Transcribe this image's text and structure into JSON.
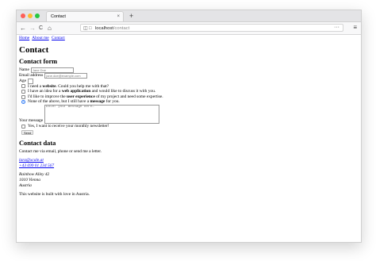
{
  "browser": {
    "tab_title": "Contact",
    "tab_close": "×",
    "new_tab": "+",
    "url_host": "localhost",
    "url_path": "/contact",
    "url_more": "···",
    "back": "←",
    "forward": "→",
    "reload": "C",
    "home": "⌂",
    "menu": "≡"
  },
  "nav": {
    "home": "Home",
    "about": "About me",
    "contact": "Contact"
  },
  "page": {
    "title": "Contact",
    "form_heading": "Contact form",
    "name_label": "Name",
    "name_placeholder": "Jane Doe",
    "email_label": "Email address",
    "email_placeholder": "jane.doe@example.com",
    "age_label": "Age",
    "options": [
      {
        "pre": "I need a ",
        "bold": "website",
        "post": ". Could you help me with that?"
      },
      {
        "pre": "I have an idea for a ",
        "bold": "web application",
        "post": " and would like to discuss it with you."
      },
      {
        "pre": "I'd like to improve the ",
        "bold": "user experience",
        "post": " of my project and need some expertise."
      },
      {
        "pre": "None of the above, but I still have a ",
        "bold": "message",
        "post": " for you."
      }
    ],
    "message_label": "Your message",
    "message_placeholder": "Enter your message here…",
    "newsletter_label": "Yes, I want to receive your monthly newsletter!",
    "send_label": "Send",
    "data_heading": "Contact data",
    "data_intro": "Contact me via email, phone or send me a letter.",
    "email": "lara@xcale.at",
    "phone": "+43 699 01 234 567",
    "address_street": "Rainbow Alley 42",
    "address_city": "1010 Vienna",
    "address_country": "Austria",
    "footer": "This website is built with love in Austria."
  },
  "colors": {
    "link": "#0000ee",
    "radio_checked": "#2f7bf5",
    "close": "#fe5f57",
    "minimize": "#febb2e",
    "zoom": "#28c840"
  }
}
